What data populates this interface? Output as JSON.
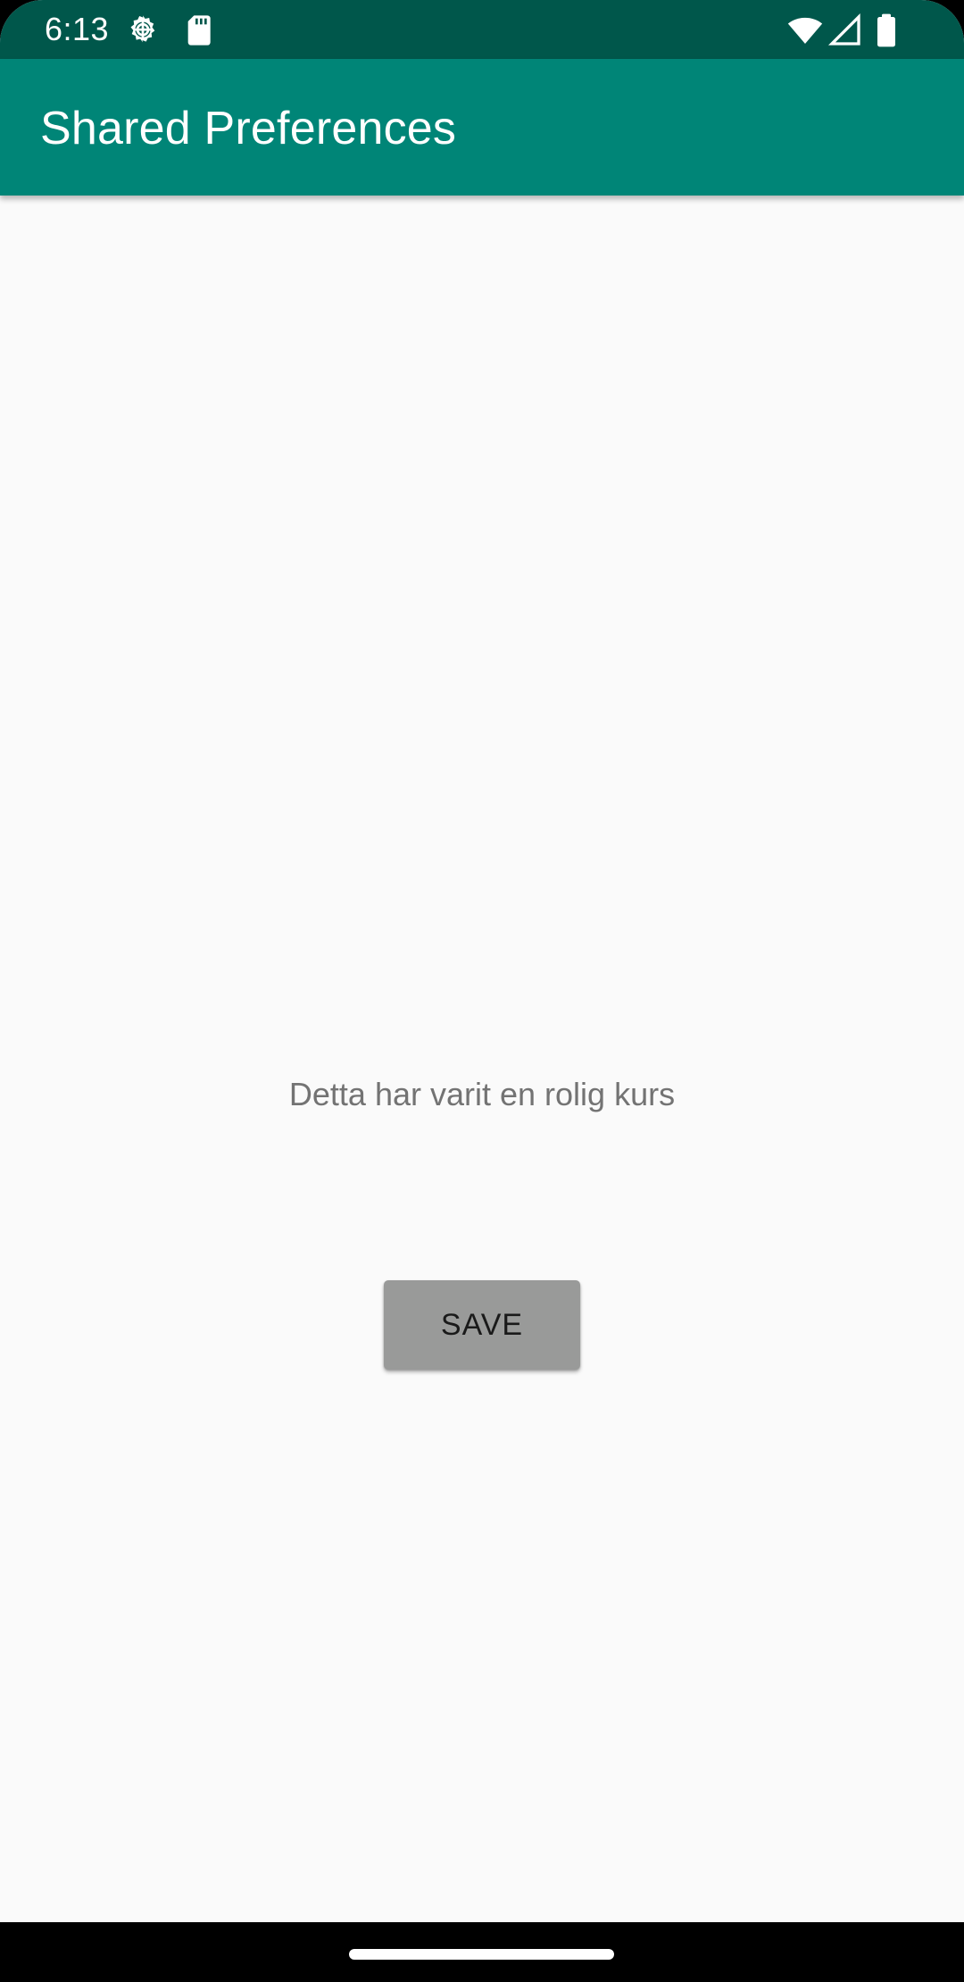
{
  "status_bar": {
    "time": "6:13",
    "icons_left": [
      "settings-gear-icon",
      "sd-card-icon"
    ],
    "icons_right": [
      "wifi-icon",
      "cell-signal-icon",
      "battery-icon"
    ],
    "color": "#00574b"
  },
  "app_bar": {
    "title": "Shared Preferences",
    "color": "#008577"
  },
  "main": {
    "message": "Detta har varit en rolig kurs",
    "save_label": "SAVE"
  },
  "nav_bar": {
    "color": "#000000"
  }
}
